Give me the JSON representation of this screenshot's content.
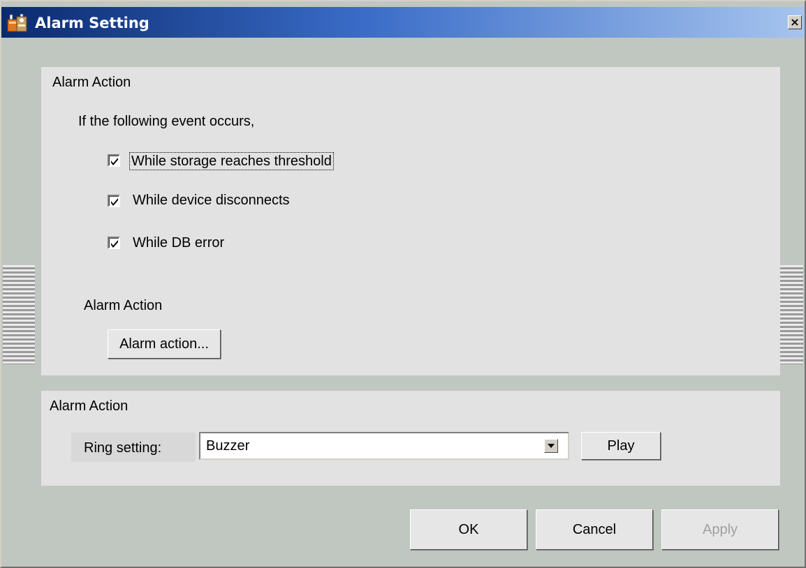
{
  "window": {
    "title": "Alarm Setting",
    "close_glyph": "×"
  },
  "event_section": {
    "title": "Alarm Action",
    "intro": "If the following event occurs,",
    "checkboxes": [
      {
        "label": "While storage reaches threshold",
        "checked": true,
        "focused": true
      },
      {
        "label": "While device disconnects",
        "checked": true,
        "focused": false
      },
      {
        "label": "While DB error",
        "checked": true,
        "focused": false
      }
    ],
    "action_label": "Alarm Action",
    "action_button": "Alarm action..."
  },
  "ring_section": {
    "title": "Alarm Action",
    "ring_label": "Ring setting:",
    "ring_value": "Buzzer",
    "play_button": "Play"
  },
  "footer": {
    "ok": "OK",
    "cancel": "Cancel",
    "apply": "Apply",
    "apply_disabled": true
  },
  "icons": {
    "title_icon": "app-settings-icon",
    "close": "close-icon",
    "checkmark": "checkmark-icon",
    "dropdown": "chevron-down-icon"
  }
}
